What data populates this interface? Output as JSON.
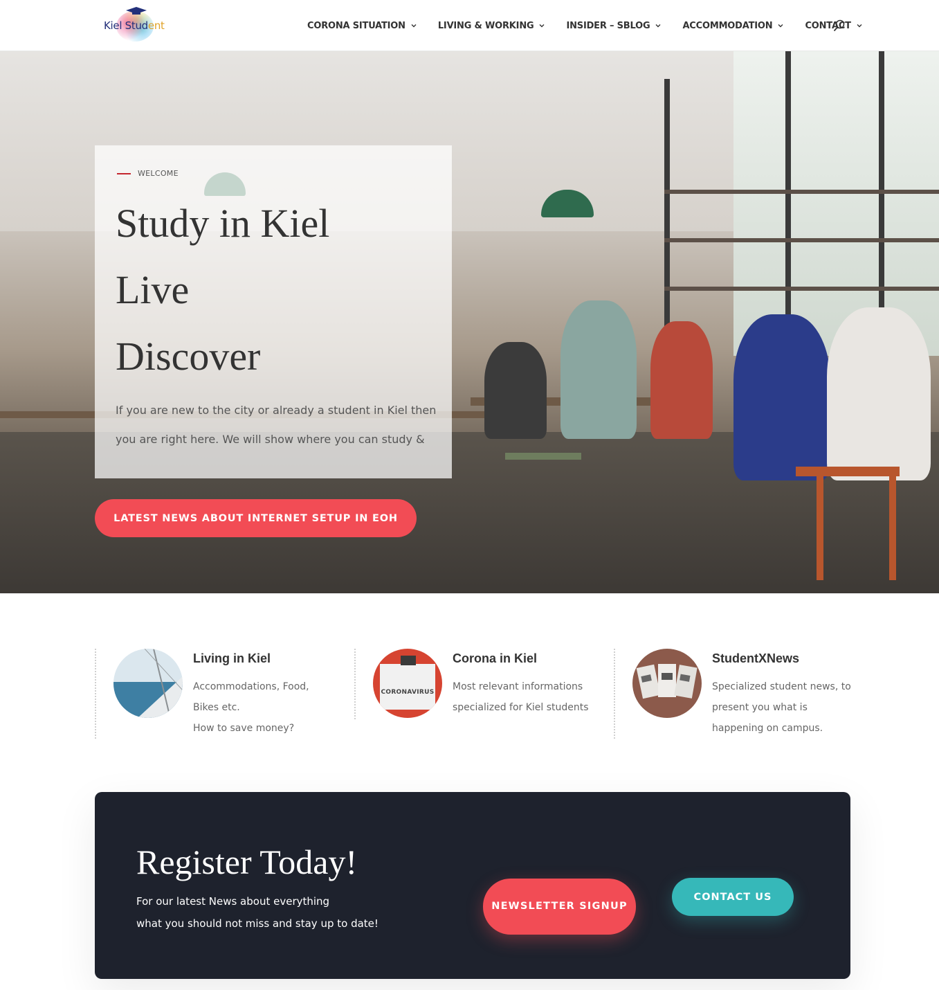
{
  "header": {
    "logo_text_a": "Kiel Stud",
    "logo_text_b": "ent",
    "nav": [
      {
        "label": "CORONA SITUATION"
      },
      {
        "label": "LIVING & WORKING"
      },
      {
        "label": "INSIDER – SBLOG"
      },
      {
        "label": "ACCOMMODATION"
      },
      {
        "label": "CONTACT"
      }
    ]
  },
  "hero": {
    "eyebrow": "WELCOME",
    "title_lines": [
      "Study in Kiel",
      "Live",
      "Discover"
    ],
    "description": "If you are new to the city or already a student in Kiel then you are right here. We will show where you can study & help you!",
    "button": "LATEST NEWS ABOUT INTERNET SETUP IN EOH"
  },
  "features": [
    {
      "title": "Living in Kiel",
      "text": "Accommodations, Food,\nBikes etc.\nHow to save money?"
    },
    {
      "title": "Corona in Kiel",
      "text": "Most relevant informations\nspecialized for Kiel students",
      "thumb_label": "CORONAVIRUS"
    },
    {
      "title": "StudentXNews",
      "text": "Specialized student news, to\npresent you what is\nhappening on campus."
    }
  ],
  "cta": {
    "title": "Register Today!",
    "text": "For our latest News about everything\nwhat you should not miss and stay up to date!",
    "newsletter_button": "NEWSLETTER SIGNUP",
    "contact_button": "CONTACT US"
  },
  "colors": {
    "accent_red": "#f24c55",
    "accent_teal": "#36b8b9",
    "cta_background": "#1e222d"
  }
}
